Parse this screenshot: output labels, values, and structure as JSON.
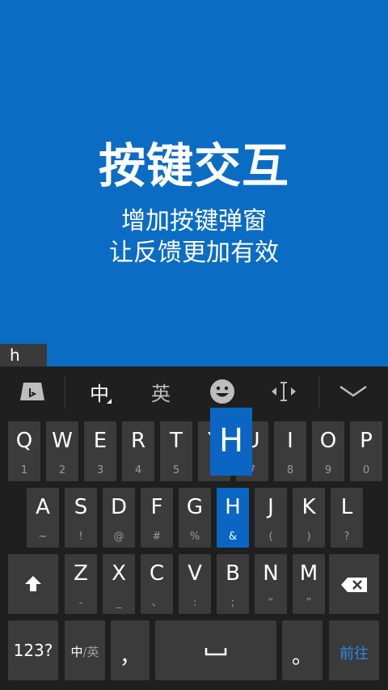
{
  "banner": {
    "title": "按键交互",
    "line1": "增加按键弹窗",
    "line2": "让反馈更加有效"
  },
  "composing_text": "h",
  "toolbar": {
    "chinese_label": "中",
    "english_label": "英",
    "icons": [
      "bing-icon",
      "emoji-icon",
      "cursor-move-icon",
      "collapse-keyboard-icon"
    ]
  },
  "popup_letter": "H",
  "rows": {
    "row1": [
      {
        "main": "Q",
        "sub": "1"
      },
      {
        "main": "W",
        "sub": "2"
      },
      {
        "main": "E",
        "sub": "3"
      },
      {
        "main": "R",
        "sub": "4"
      },
      {
        "main": "T",
        "sub": "5"
      },
      {
        "main": "Y",
        "sub": "6"
      },
      {
        "main": "U",
        "sub": "7"
      },
      {
        "main": "I",
        "sub": "8"
      },
      {
        "main": "O",
        "sub": "9"
      },
      {
        "main": "P",
        "sub": "0"
      }
    ],
    "row2": [
      {
        "main": "A",
        "sub": "~"
      },
      {
        "main": "S",
        "sub": "!"
      },
      {
        "main": "D",
        "sub": "@"
      },
      {
        "main": "F",
        "sub": "#"
      },
      {
        "main": "G",
        "sub": "%"
      },
      {
        "main": "H",
        "sub": "&"
      },
      {
        "main": "J",
        "sub": "("
      },
      {
        "main": "K",
        "sub": ")"
      },
      {
        "main": "L",
        "sub": "?"
      }
    ],
    "row3": [
      {
        "main": "Z",
        "sub": "-"
      },
      {
        "main": "X",
        "sub": "_"
      },
      {
        "main": "C",
        "sub": "、"
      },
      {
        "main": "V",
        "sub": ":"
      },
      {
        "main": "B",
        "sub": ";"
      },
      {
        "main": "N",
        "sub": "“"
      },
      {
        "main": "M",
        "sub": "”"
      }
    ]
  },
  "bottom": {
    "numbers": "123?",
    "lang_zh": "中",
    "lang_sep": "/英",
    "comma": "，",
    "period": "。",
    "enter": "前往"
  },
  "colors": {
    "accent": "#0a66c2",
    "banner": "#0b6cc4",
    "key": "#3b3b3b",
    "keyboard_bg": "#1f1f1f"
  }
}
